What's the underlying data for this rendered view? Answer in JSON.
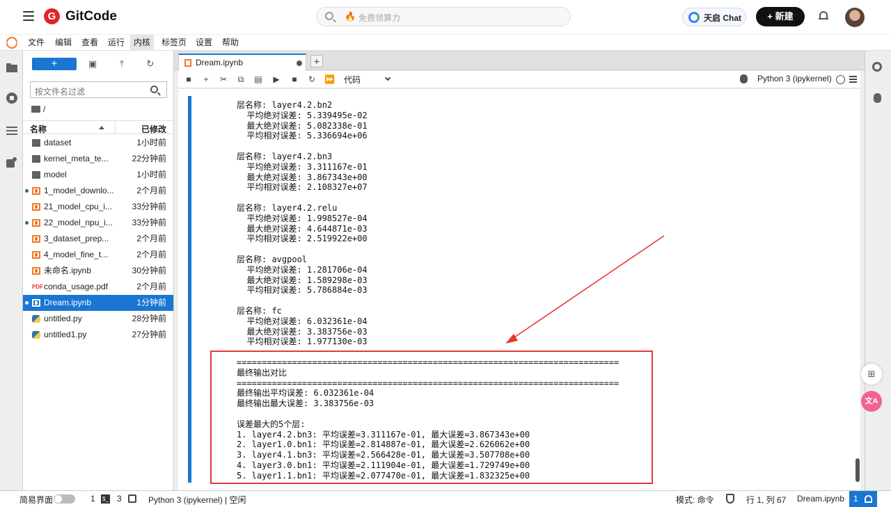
{
  "header": {
    "brand": "GitCode",
    "search_placeholder": "免费领算力",
    "chat_label": "天启 Chat",
    "new_label": "+ 新建"
  },
  "menu": [
    "文件",
    "编辑",
    "查看",
    "运行",
    "内核",
    "标签页",
    "设置",
    "帮助"
  ],
  "menu_active": "内核",
  "filebrowser": {
    "filter_placeholder": "按文件名过滤",
    "breadcrumb": "/",
    "col_name": "名称",
    "col_modified": "已修改",
    "files": [
      {
        "name": "dataset",
        "time": "1小时前",
        "type": "folder",
        "running": false,
        "selected": false
      },
      {
        "name": "kernel_meta_te...",
        "time": "22分钟前",
        "type": "folder",
        "running": false,
        "selected": false
      },
      {
        "name": "model",
        "time": "1小时前",
        "type": "folder",
        "running": false,
        "selected": false
      },
      {
        "name": "1_model_downlo...",
        "time": "2个月前",
        "type": "notebook",
        "running": true,
        "selected": false
      },
      {
        "name": "21_model_cpu_i...",
        "time": "33分钟前",
        "type": "notebook",
        "running": false,
        "selected": false
      },
      {
        "name": "22_model_npu_i...",
        "time": "33分钟前",
        "type": "notebook",
        "running": true,
        "selected": false
      },
      {
        "name": "3_dataset_prep...",
        "time": "2个月前",
        "type": "notebook",
        "running": false,
        "selected": false
      },
      {
        "name": "4_model_fine_t...",
        "time": "2个月前",
        "type": "notebook",
        "running": false,
        "selected": false
      },
      {
        "name": "未命名.ipynb",
        "time": "30分钟前",
        "type": "notebook",
        "running": false,
        "selected": false
      },
      {
        "name": "conda_usage.pdf",
        "time": "2个月前",
        "type": "pdf",
        "running": false,
        "selected": false
      },
      {
        "name": "Dream.ipynb",
        "time": "1分钟前",
        "type": "notebook",
        "running": true,
        "selected": true
      },
      {
        "name": "untitled.py",
        "time": "28分钟前",
        "type": "python",
        "running": false,
        "selected": false
      },
      {
        "name": "untitled1.py",
        "time": "27分钟前",
        "type": "python",
        "running": false,
        "selected": false
      }
    ]
  },
  "tab": {
    "title": "Dream.ipynb"
  },
  "toolbar": {
    "cell_type": "代码",
    "kernel": "Python 3 (ipykernel)"
  },
  "output_lines": [
    "层名称: layer4.2.bn2",
    "  平均绝对误差: 5.339495e-02",
    "  最大绝对误差: 5.082338e-01",
    "  平均相对误差: 5.336694e+06",
    "",
    "层名称: layer4.2.bn3",
    "  平均绝对误差: 3.311167e-01",
    "  最大绝对误差: 3.867343e+00",
    "  平均相对误差: 2.108327e+07",
    "",
    "层名称: layer4.2.relu",
    "  平均绝对误差: 1.998527e-04",
    "  最大绝对误差: 4.644871e-03",
    "  平均相对误差: 2.519922e+00",
    "",
    "层名称: avgpool",
    "  平均绝对误差: 1.281706e-04",
    "  最大绝对误差: 1.589298e-03",
    "  平均相对误差: 5.786884e-03",
    "",
    "层名称: fc",
    "  平均绝对误差: 6.032361e-04",
    "  最大绝对误差: 3.383756e-03",
    "  平均相对误差: 1.977130e-03",
    "",
    "============================================================================",
    "最终输出对比",
    "============================================================================",
    "最终输出平均误差: 6.032361e-04",
    "最终输出最大误差: 3.383756e-03",
    "",
    "误差最大的5个层:",
    "1. layer4.2.bn3: 平均误差=3.311167e-01, 最大误差=3.867343e+00",
    "2. layer1.0.bn1: 平均误差=2.814887e-01, 最大误差=2.626062e+00",
    "3. layer4.1.bn3: 平均误差=2.566428e-01, 最大误差=3.507708e+00",
    "4. layer3.0.bn1: 平均误差=2.111904e-01, 最大误差=1.729749e+00",
    "5. layer1.1.bn1: 平均误差=2.077470e-01, 最大误差=1.832325e+00"
  ],
  "status": {
    "simple_mode": "简易界面",
    "terminals": "1",
    "kernels": "3",
    "kernel_status": "Python 3 (ipykernel) | 空闲",
    "mode": "模式: 命令",
    "cursor": "行 1, 列 67",
    "file": "Dream.ipynb",
    "notifications": "1"
  },
  "colors": {
    "accent": "#1976d2",
    "highlight_box": "#e53935",
    "jupyter_orange": "#f37726"
  }
}
